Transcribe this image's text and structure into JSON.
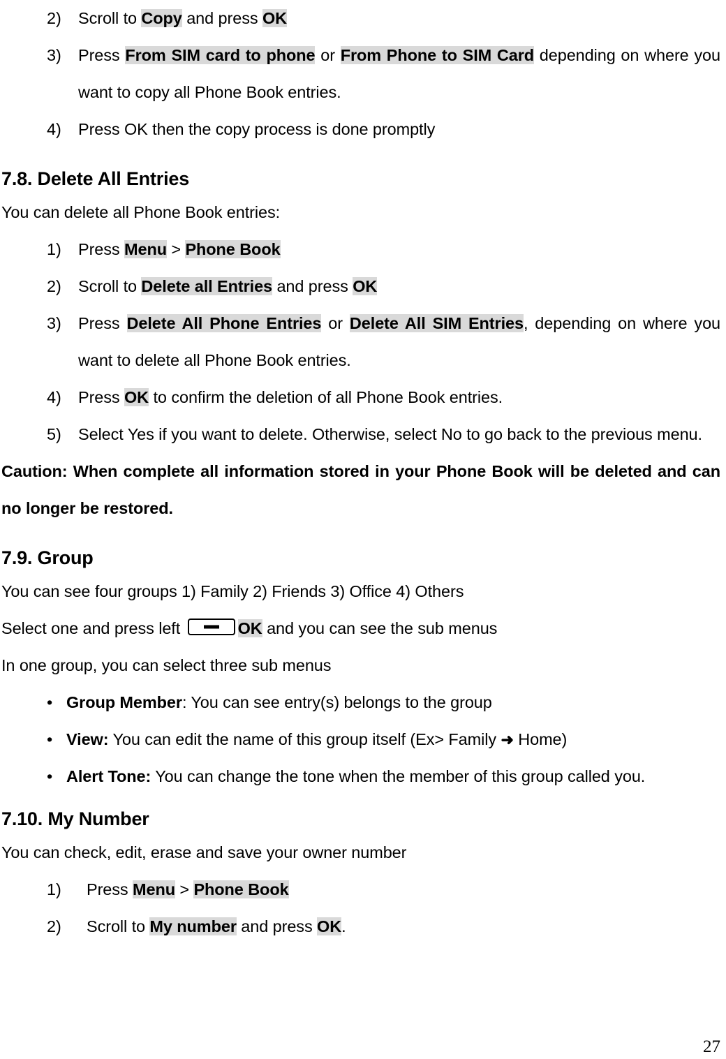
{
  "page": {
    "number": "27",
    "highlight_color": "#d9d9d9",
    "text_color": "#000000",
    "background_color": "#ffffff"
  },
  "top_list": {
    "items": [
      {
        "marker": "2)",
        "runs": [
          {
            "t": "Scroll to ",
            "s": "plain"
          },
          {
            "t": "Copy",
            "s": "highlight"
          },
          {
            "t": " and press ",
            "s": "plain"
          },
          {
            "t": "OK",
            "s": "highlight"
          }
        ]
      },
      {
        "marker": "3)",
        "runs": [
          {
            "t": "Press ",
            "s": "plain"
          },
          {
            "t": "From SIM card to phone",
            "s": "highlight"
          },
          {
            "t": " or ",
            "s": "plain"
          },
          {
            "t": "From Phone to SIM Card",
            "s": "highlight"
          },
          {
            "t": " depending on where you want to copy all Phone Book entries.",
            "s": "plain"
          }
        ]
      },
      {
        "marker": "4)",
        "runs": [
          {
            "t": "Press OK then the copy process is done promptly",
            "s": "plain"
          }
        ]
      }
    ]
  },
  "section_7_8": {
    "heading": "7.8. Delete All Entries",
    "intro": "You can delete all Phone Book entries:",
    "items": [
      {
        "marker": "1)",
        "runs": [
          {
            "t": "Press ",
            "s": "plain"
          },
          {
            "t": "Menu",
            "s": "highlight"
          },
          {
            "t": " > ",
            "s": "plain"
          },
          {
            "t": "Phone Book",
            "s": "highlight"
          }
        ]
      },
      {
        "marker": "2)",
        "runs": [
          {
            "t": "Scroll to ",
            "s": "plain"
          },
          {
            "t": "Delete all Entries",
            "s": "highlight"
          },
          {
            "t": " and press ",
            "s": "plain"
          },
          {
            "t": "OK",
            "s": "highlight"
          }
        ]
      },
      {
        "marker": "3)",
        "runs": [
          {
            "t": "Press ",
            "s": "plain"
          },
          {
            "t": "Delete All Phone Entries",
            "s": "highlight"
          },
          {
            "t": " or ",
            "s": "plain"
          },
          {
            "t": "Delete All SIM Entries",
            "s": "highlight"
          },
          {
            "t": ", depending on where you want to delete all Phone Book entries.",
            "s": "plain"
          }
        ]
      },
      {
        "marker": "4)",
        "runs": [
          {
            "t": "Press ",
            "s": "plain"
          },
          {
            "t": "OK",
            "s": "highlight"
          },
          {
            "t": " to confirm the deletion of all Phone Book entries.",
            "s": "plain"
          }
        ]
      },
      {
        "marker": "5)",
        "runs": [
          {
            "t": "Select Yes if you want to delete. Otherwise, select No to go back to the previous menu.",
            "s": "plain"
          }
        ]
      }
    ],
    "caution": "Caution: When complete all information stored in your Phone Book will be deleted and can no longer be restored."
  },
  "section_7_9": {
    "heading": "7.9. Group",
    "groups_line": "You can see four groups 1) Family 2) Friends 3) Office 4) Others",
    "select_line": {
      "before": "Select one and press left ",
      "softkey_icon": "left-softkey-icon",
      "key_label": "OK",
      "after": " and you can see the sub menus"
    },
    "submenu_line": "In one group, you can select three sub menus",
    "bullets": [
      {
        "bullet": "•",
        "runs": [
          {
            "t": "Group Member",
            "s": "bold"
          },
          {
            "t": ": You can see entry(s) belongs to the group",
            "s": "plain"
          }
        ]
      },
      {
        "bullet": "•",
        "runs": [
          {
            "t": "View:",
            "s": "bold"
          },
          {
            "t": " You can edit the name of this group itself (Ex> Family ",
            "s": "plain"
          },
          {
            "t": "➜",
            "s": "arrow"
          },
          {
            "t": " Home)",
            "s": "plain"
          }
        ]
      },
      {
        "bullet": "•",
        "runs": [
          {
            "t": "Alert Tone:",
            "s": "bold"
          },
          {
            "t": " You can change the tone when the member of this group called you.",
            "s": "plain"
          }
        ]
      }
    ]
  },
  "section_7_10": {
    "heading": "7.10. My Number",
    "intro": "You can check, edit, erase and save your owner number",
    "items": [
      {
        "marker": "1)",
        "runs": [
          {
            "t": "Press ",
            "s": "plain"
          },
          {
            "t": "Menu",
            "s": "highlight"
          },
          {
            "t": " > ",
            "s": "plain"
          },
          {
            "t": "Phone Book",
            "s": "highlight"
          }
        ]
      },
      {
        "marker": "2)",
        "runs": [
          {
            "t": "Scroll to ",
            "s": "plain"
          },
          {
            "t": "My number",
            "s": "highlight"
          },
          {
            "t": " and press ",
            "s": "plain"
          },
          {
            "t": "OK",
            "s": "highlight"
          },
          {
            "t": ".",
            "s": "plain"
          }
        ]
      }
    ]
  }
}
